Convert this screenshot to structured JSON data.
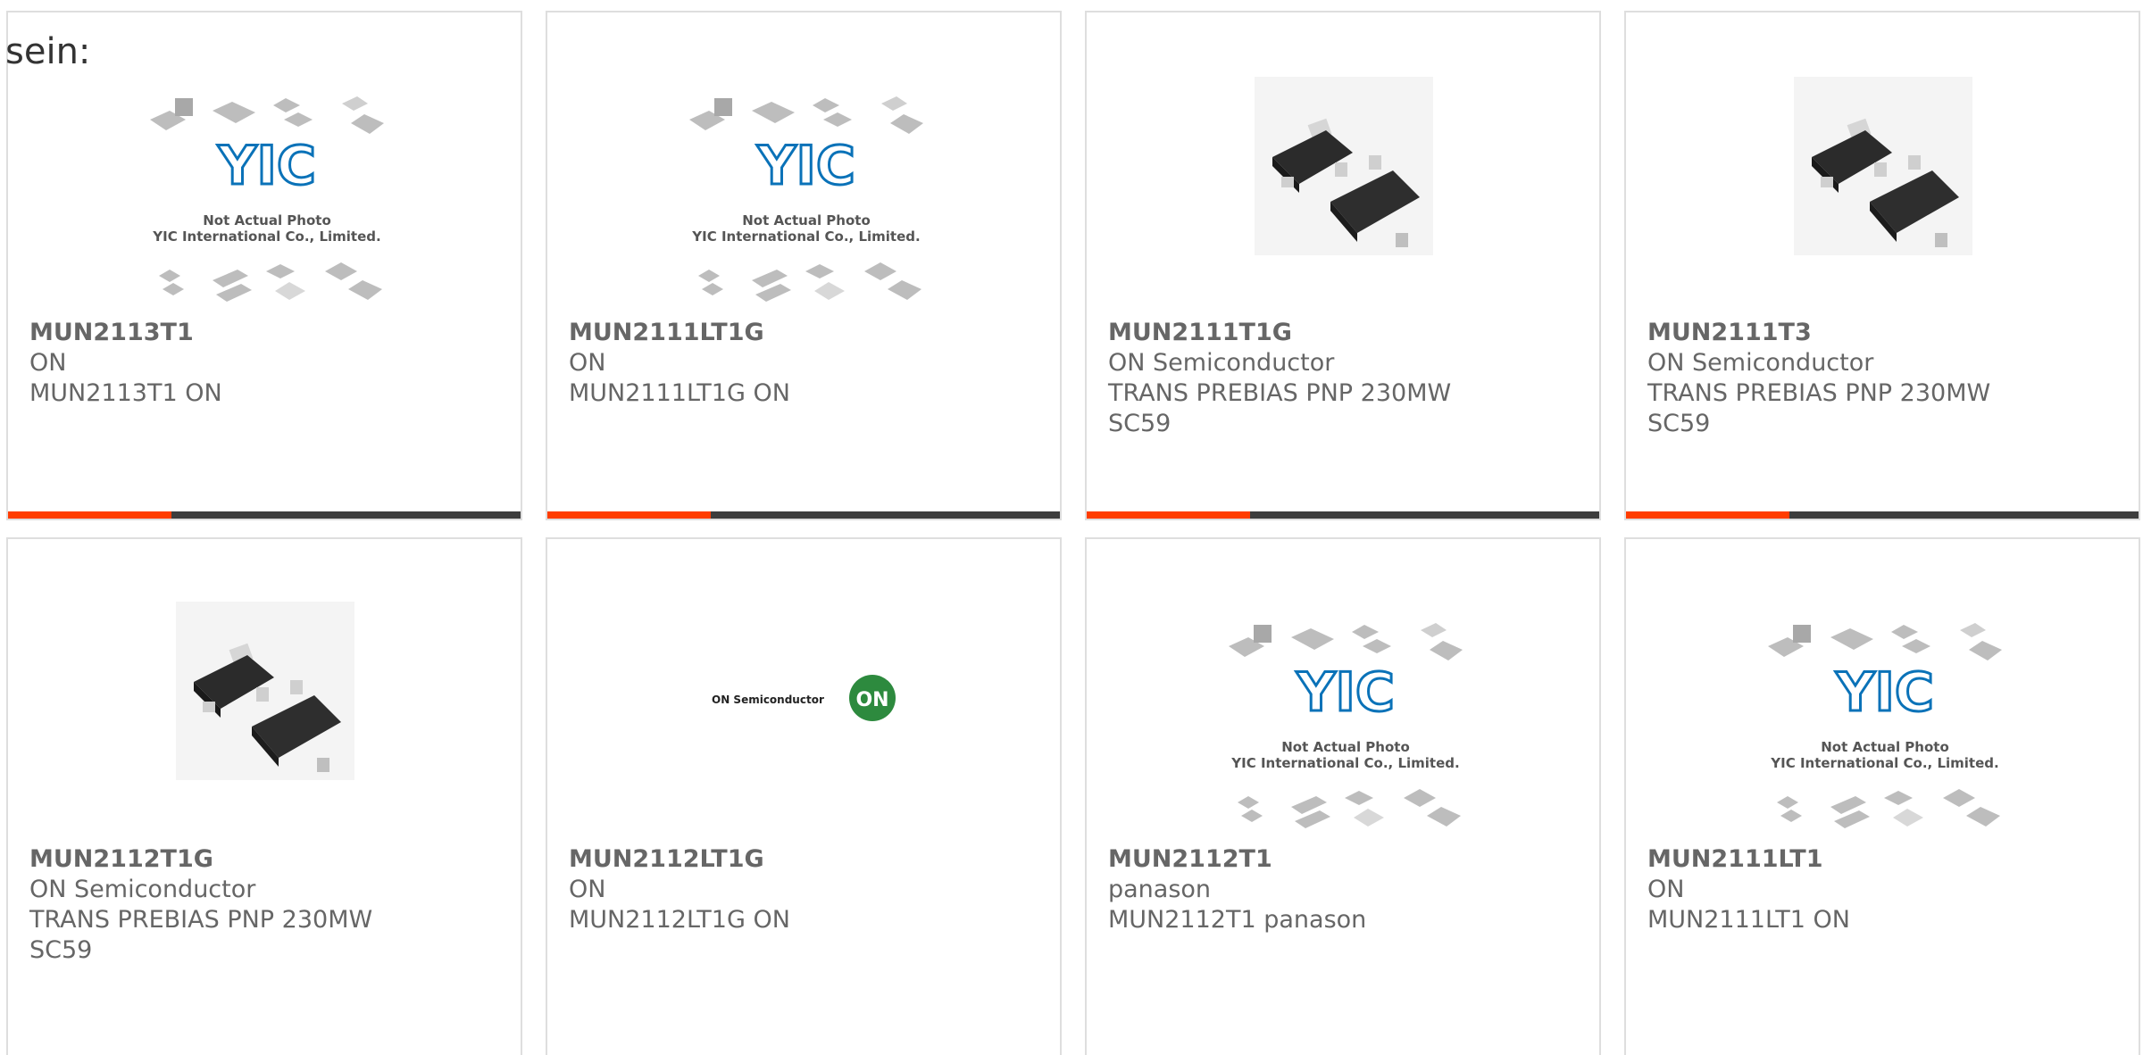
{
  "page": {
    "label": "sein:"
  },
  "colors": {
    "accent": "#ff3d00",
    "bar": "#3d3d3d",
    "border": "#dedede",
    "text": "#666666",
    "yic_blue": "#0a72b8",
    "on_green": "#2d8a3e"
  },
  "placeholder": {
    "line1": "Not Actual Photo",
    "line2": "YIC International Co., Limited.",
    "logo": "YIC"
  },
  "on_logo": {
    "text": "ON Semiconductor",
    "mark": "ON"
  },
  "products": [
    {
      "part": "MUN2113T1",
      "brand": "ON",
      "desc_lines": [
        "MUN2113T1 ON"
      ],
      "image": "yic-placeholder"
    },
    {
      "part": "MUN2111LT1G",
      "brand": "ON",
      "desc_lines": [
        "MUN2111LT1G ON"
      ],
      "image": "yic-placeholder"
    },
    {
      "part": "MUN2111T1G",
      "brand": "ON Semiconductor",
      "desc_lines": [
        "TRANS PREBIAS PNP 230MW",
        "SC59"
      ],
      "image": "sot-chip-photo"
    },
    {
      "part": "MUN2111T3",
      "brand": "ON Semiconductor",
      "desc_lines": [
        "TRANS PREBIAS PNP 230MW",
        "SC59"
      ],
      "image": "sot-chip-photo"
    },
    {
      "part": "MUN2112T1G",
      "brand": "ON Semiconductor",
      "desc_lines": [
        "TRANS PREBIAS PNP 230MW",
        "SC59"
      ],
      "image": "sot-chip-photo"
    },
    {
      "part": "MUN2112LT1G",
      "brand": "ON",
      "desc_lines": [
        "MUN2112LT1G ON"
      ],
      "image": "on-semiconductor-logo"
    },
    {
      "part": "MUN2112T1",
      "brand": "panason",
      "desc_lines": [
        "MUN2112T1 panason"
      ],
      "image": "yic-placeholder"
    },
    {
      "part": "MUN2111LT1",
      "brand": "ON",
      "desc_lines": [
        "MUN2111LT1 ON"
      ],
      "image": "yic-placeholder"
    }
  ]
}
